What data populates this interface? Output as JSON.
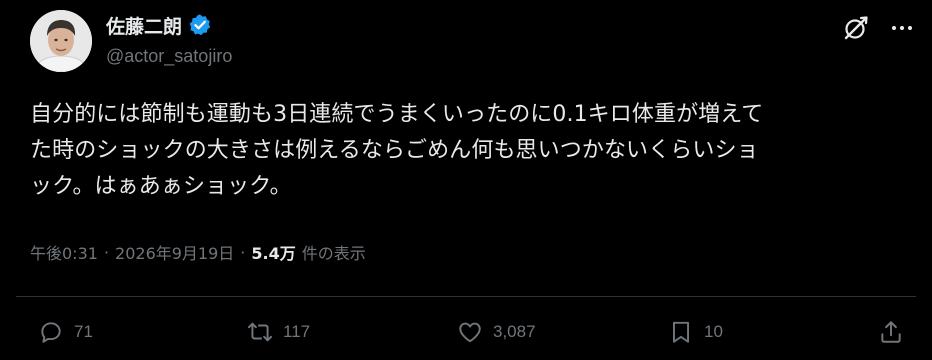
{
  "author": {
    "display_name": "佐藤二朗",
    "handle": "@actor_satojiro",
    "verified_color": "#1d9bf0"
  },
  "tweet": {
    "lines": [
      "自分的には節制も運動も3日連続でうまくいったのに0.1キロ体重が増えて",
      "た時のショックの大きさは例えるならごめん何も思いつかないくらいショ",
      "ック。はぁあぁショック。"
    ]
  },
  "meta": {
    "time": "午後0:31",
    "separator": "·",
    "date": "2026年9月19日",
    "views_count": "5.4万",
    "views_label": "件の表示"
  },
  "actions": {
    "replies": "71",
    "retweets": "117",
    "likes": "3,087",
    "bookmarks": "10"
  },
  "icons": {
    "grok": "grok-icon",
    "more": "more-icon",
    "reply": "reply-icon",
    "retweet": "retweet-icon",
    "like": "heart-icon",
    "bookmark": "bookmark-icon",
    "share": "share-icon"
  },
  "colors": {
    "background": "#000000",
    "text": "#e7e9ea",
    "secondary": "#71767b",
    "divider": "#2f3336"
  }
}
